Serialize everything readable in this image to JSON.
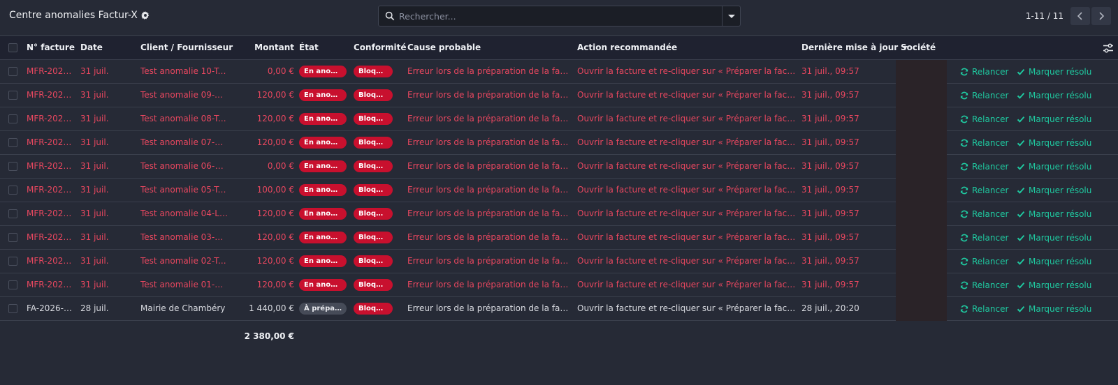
{
  "control_panel": {
    "title": "Centre anomalies Factur-X",
    "search_placeholder": "Rechercher...",
    "pager_value": "1-11 / 11"
  },
  "columns": {
    "invoice_number": "N° facture",
    "date": "Date",
    "partner": "Client / Fournisseur",
    "amount": "Montant",
    "state": "État",
    "compliance": "Conformité",
    "cause": "Cause probable",
    "action": "Action recommandée",
    "last_update": "Dernière mise à jour",
    "company": "Société"
  },
  "row_actions": {
    "retry_label": "Relancer",
    "resolve_label": "Marquer résolu"
  },
  "rows": [
    {
      "number": "MFR-2026...",
      "date": "31 juil.",
      "partner": "Test anomalie 10-To...",
      "amount": "0,00 €",
      "state": "En anom...",
      "state_kind": "anomaly",
      "compliance": "Bloquée",
      "cause": "Erreur lors de la préparation de la factur...",
      "action": "Ouvrir la facture et re-cliquer sur « Préparer la facture é...",
      "updated": "31 juil., 09:57"
    },
    {
      "number": "MFR-2026...",
      "date": "31 juil.",
      "partner": "Test anomalie 09-A...",
      "amount": "120,00 €",
      "state": "En anom...",
      "state_kind": "anomaly",
      "compliance": "Bloquée",
      "cause": "Erreur lors de la préparation de la factur...",
      "action": "Ouvrir la facture et re-cliquer sur « Préparer la facture é...",
      "updated": "31 juil., 09:57"
    },
    {
      "number": "MFR-2026...",
      "date": "31 juil.",
      "partner": "Test anomalie 08-T...",
      "amount": "120,00 €",
      "state": "En anom...",
      "state_kind": "anomaly",
      "compliance": "Bloquée",
      "cause": "Erreur lors de la préparation de la factur...",
      "action": "Ouvrir la facture et re-cliquer sur « Préparer la facture é...",
      "updated": "31 juil., 09:57"
    },
    {
      "number": "MFR-2026...",
      "date": "31 juil.",
      "partner": "Test anomalie 07-SI...",
      "amount": "120,00 €",
      "state": "En anom...",
      "state_kind": "anomaly",
      "compliance": "Bloquée",
      "cause": "Erreur lors de la préparation de la factur...",
      "action": "Ouvrir la facture et re-cliquer sur « Préparer la facture é...",
      "updated": "31 juil., 09:57"
    },
    {
      "number": "MFR-2026...",
      "date": "31 juil.",
      "partner": "Test anomalie 06-Q...",
      "amount": "0,00 €",
      "state": "En anom...",
      "state_kind": "anomaly",
      "compliance": "Bloquée",
      "cause": "Erreur lors de la préparation de la factur...",
      "action": "Ouvrir la facture et re-cliquer sur « Préparer la facture é...",
      "updated": "31 juil., 09:57"
    },
    {
      "number": "MFR-2026...",
      "date": "31 juil.",
      "partner": "Test anomalie 05-Ta...",
      "amount": "100,00 €",
      "state": "En anom...",
      "state_kind": "anomaly",
      "compliance": "Bloquée",
      "cause": "Erreur lors de la préparation de la factur...",
      "action": "Ouvrir la facture et re-cliquer sur « Préparer la facture é...",
      "updated": "31 juil., 09:57"
    },
    {
      "number": "MFR-2026...",
      "date": "31 juil.",
      "partner": "Test anomalie 04-Li...",
      "amount": "120,00 €",
      "state": "En anom...",
      "state_kind": "anomaly",
      "compliance": "Bloquée",
      "cause": "Erreur lors de la préparation de la factur...",
      "action": "Ouvrir la facture et re-cliquer sur « Préparer la facture é...",
      "updated": "31 juil., 09:57"
    },
    {
      "number": "MFR-2026...",
      "date": "31 juil.",
      "partner": "Test anomalie 03-E...",
      "amount": "120,00 €",
      "state": "En anom...",
      "state_kind": "anomaly",
      "compliance": "Bloquée",
      "cause": "Erreur lors de la préparation de la factur...",
      "action": "Ouvrir la facture et re-cliquer sur « Préparer la facture é...",
      "updated": "31 juil., 09:57"
    },
    {
      "number": "MFR-2026...",
      "date": "31 juil.",
      "partner": "Test anomalie 02-T...",
      "amount": "120,00 €",
      "state": "En anom...",
      "state_kind": "anomaly",
      "compliance": "Bloquée",
      "cause": "Erreur lors de la préparation de la factur...",
      "action": "Ouvrir la facture et re-cliquer sur « Préparer la facture é...",
      "updated": "31 juil., 09:57"
    },
    {
      "number": "MFR-2026...",
      "date": "31 juil.",
      "partner": "Test anomalie 01-SI...",
      "amount": "120,00 €",
      "state": "En anom...",
      "state_kind": "anomaly",
      "compliance": "Bloquée",
      "cause": "Erreur lors de la préparation de la factur...",
      "action": "Ouvrir la facture et re-cliquer sur « Préparer la facture é...",
      "updated": "31 juil., 09:57"
    },
    {
      "number": "FA-2026-0...",
      "date": "28 juil.",
      "partner": "Mairie de Chambéry",
      "amount": "1 440,00 €",
      "state": "À préparer",
      "state_kind": "normal",
      "compliance": "Bloquée",
      "cause": "Erreur lors de la préparation de la factur...",
      "action": "Ouvrir la facture et re-cliquer sur « Préparer la facture é...",
      "updated": "28 juil., 20:20"
    }
  ],
  "footer": {
    "amount_total": "2 380,00 €"
  },
  "colors": {
    "anomaly_text": "#e8475f",
    "badge_red": "#c8102e",
    "action_teal": "#1fc9a0",
    "background": "#262a36"
  },
  "icons": [
    "gear-icon",
    "search-icon",
    "caret-down-icon",
    "chevron-left-icon",
    "chevron-right-icon",
    "sliders-icon",
    "refresh-icon",
    "check-icon"
  ]
}
